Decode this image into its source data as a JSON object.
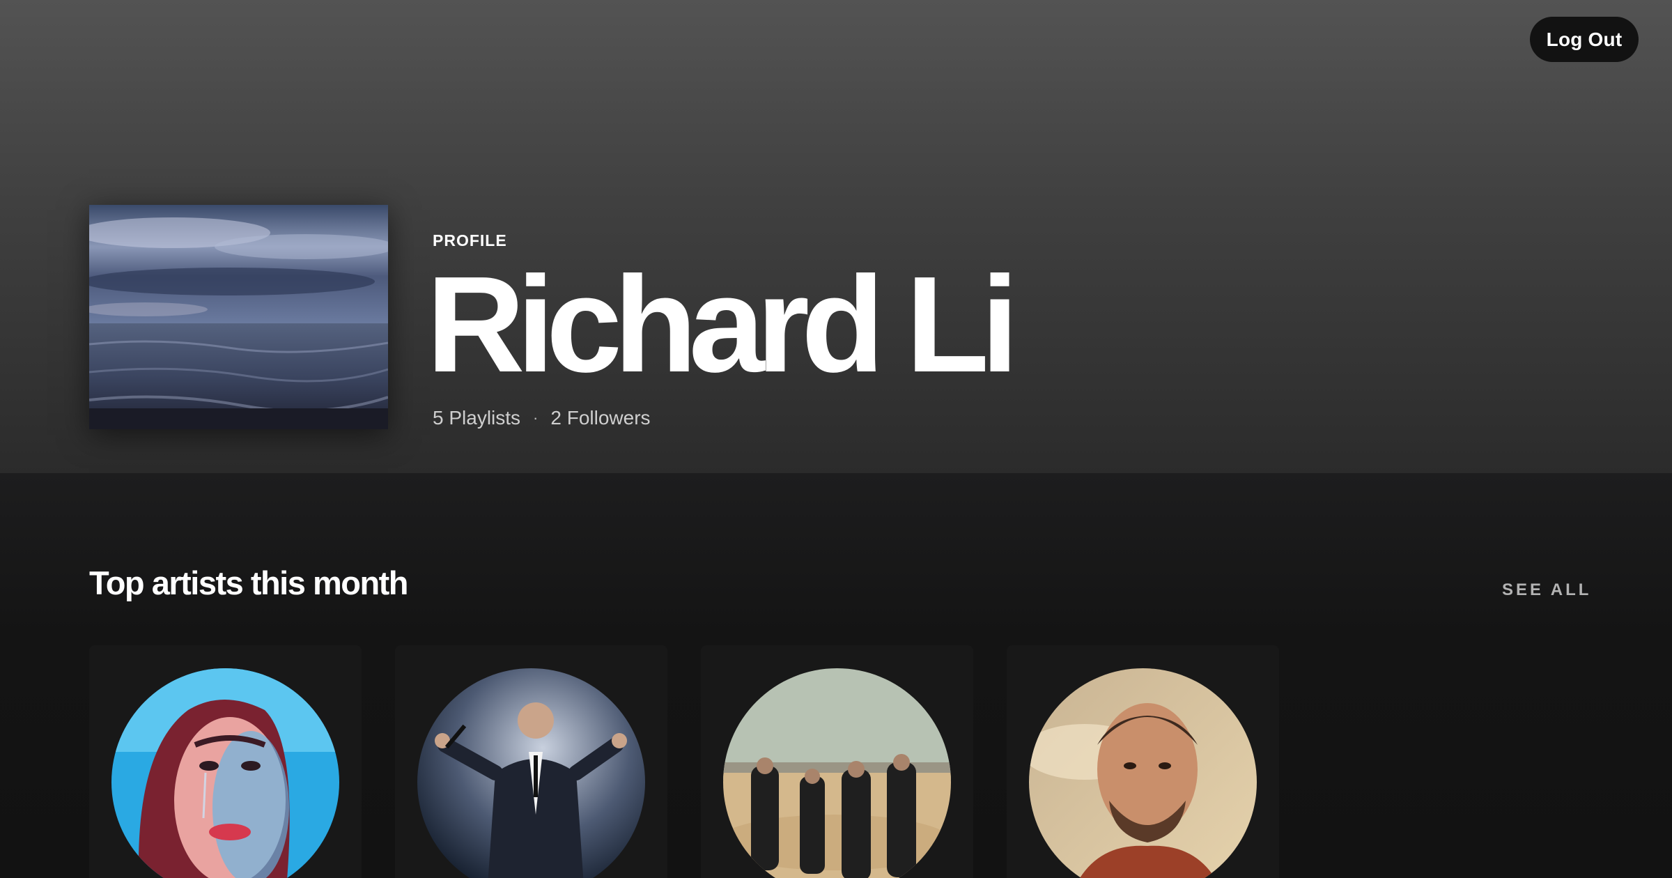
{
  "header": {
    "logout_label": "Log Out",
    "profile_label": "PROFILE",
    "profile_name": "Richard Li",
    "playlists": "5 Playlists",
    "separator": "·",
    "followers": "2 Followers"
  },
  "top_artists": {
    "title": "Top artists this month",
    "see_all_label": "SEE ALL",
    "cards": [
      {
        "image": "artist-portrait-woman-blue"
      },
      {
        "image": "artist-singer-microphone"
      },
      {
        "image": "artist-band-desert"
      },
      {
        "image": "artist-portrait-man"
      }
    ]
  },
  "colors": {
    "hero_top": "#535353",
    "background": "#121212",
    "card": "#181818",
    "muted_text": "#b3b3b3"
  }
}
